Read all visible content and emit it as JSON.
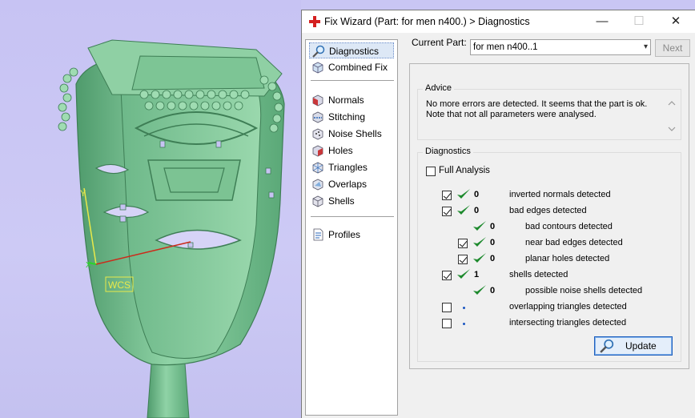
{
  "window": {
    "title": "Fix Wizard (Part: for men n400.) > Diagnostics",
    "controls": {
      "minimize": "—",
      "maximize": "☐",
      "close": "✕"
    }
  },
  "nav": {
    "top_items": [
      {
        "label": "Diagnostics",
        "icon": "magnifier-icon",
        "selected": true
      },
      {
        "label": "Combined Fix",
        "icon": "cube-icon",
        "selected": false
      }
    ],
    "fix_items": [
      {
        "label": "Normals",
        "icon": "normals-cube-icon"
      },
      {
        "label": "Stitching",
        "icon": "stitching-icon"
      },
      {
        "label": "Noise Shells",
        "icon": "noise-shells-icon"
      },
      {
        "label": "Holes",
        "icon": "holes-cube-icon"
      },
      {
        "label": "Triangles",
        "icon": "triangles-icon"
      },
      {
        "label": "Overlaps",
        "icon": "overlaps-icon"
      },
      {
        "label": "Shells",
        "icon": "shells-cube-icon"
      }
    ],
    "bottom_items": [
      {
        "label": "Profiles",
        "icon": "profiles-icon"
      }
    ]
  },
  "header": {
    "current_part_label": "Current Part:",
    "current_part_value": "for men n400..1",
    "next_label": "Next"
  },
  "advice": {
    "group_label": "Advice",
    "text_line1": "No more errors are detected. It seems that the part is ok.",
    "text_line2": "Note that not all parameters were analysed."
  },
  "diagnostics": {
    "group_label": "Diagnostics",
    "full_analysis_label": "Full Analysis",
    "rows": [
      {
        "checked": true,
        "status": "ok",
        "value": "0",
        "label": "inverted normals detected",
        "indent": 0,
        "has_checkbox": true
      },
      {
        "checked": true,
        "status": "ok",
        "value": "0",
        "label": "bad edges detected",
        "indent": 0,
        "has_checkbox": true
      },
      {
        "checked": false,
        "status": "ok",
        "value": "0",
        "label": "bad contours detected",
        "indent": 1,
        "has_checkbox": false
      },
      {
        "checked": true,
        "status": "ok",
        "value": "0",
        "label": "near bad edges detected",
        "indent": 1,
        "has_checkbox": true
      },
      {
        "checked": true,
        "status": "ok",
        "value": "0",
        "label": "planar holes detected",
        "indent": 1,
        "has_checkbox": true
      },
      {
        "checked": true,
        "status": "ok",
        "value": "1",
        "label": "shells detected",
        "indent": 0,
        "has_checkbox": true
      },
      {
        "checked": false,
        "status": "ok",
        "value": "0",
        "label": "possible noise shells detected",
        "indent": 1,
        "has_checkbox": false
      },
      {
        "checked": false,
        "status": "pending",
        "value": "",
        "label": "overlapping triangles detected",
        "indent": 0,
        "has_checkbox": true
      },
      {
        "checked": false,
        "status": "pending",
        "value": "",
        "label": "intersecting triangles detected",
        "indent": 0,
        "has_checkbox": true
      }
    ],
    "update_label": "Update"
  },
  "viewport": {
    "wcs_label": "WCS",
    "axis_y_label": "Y",
    "axis_x_label": "X",
    "colors": {
      "background": "#c9c6f4",
      "model": "#7fc79a",
      "model_dark": "#3f8a5a"
    }
  },
  "colors": {
    "accent": "#1f5fbd",
    "check_green": "#1e8a2e",
    "selection": "#dde8f6"
  }
}
